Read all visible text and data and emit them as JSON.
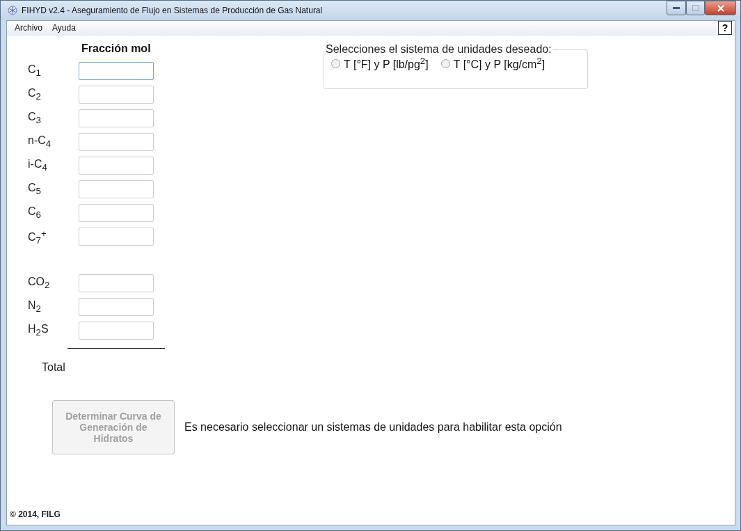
{
  "window": {
    "title": "FIHYD v2.4 - Aseguramiento de Flujo en Sistemas de Producción de Gas Natural"
  },
  "menu": [
    "Archivo",
    "Ayuda"
  ],
  "help_button": "?",
  "column_header": "Fracción mol",
  "component_groups": [
    [
      {
        "label": "C$_{1}$",
        "focused": true
      },
      {
        "label": "C$_{2}$",
        "focused": false
      },
      {
        "label": "C$_{3}$",
        "focused": false
      },
      {
        "label": "n-C$_{4}$",
        "focused": false
      },
      {
        "label": "i-C$_{4}$",
        "focused": false
      },
      {
        "label": "C$_{5}$",
        "focused": false
      },
      {
        "label": "C$_{6}$",
        "focused": false
      },
      {
        "label": "C$_{7}$$^{+}$",
        "focused": false
      }
    ],
    [
      {
        "label": "CO$_{2}$",
        "focused": false
      },
      {
        "label": "N$_{2}$",
        "focused": false
      },
      {
        "label": "H$_{2}$S",
        "focused": false
      }
    ]
  ],
  "total_label": "Total",
  "units": {
    "legend": "Selecciones el sistema de unidades deseado:",
    "options": [
      {
        "label": "T [°F] y P [lb/pg$^{2}$]",
        "selected": false
      },
      {
        "label": "T [°C] y P [kg/cm$^{2}$]",
        "selected": false
      }
    ]
  },
  "action_button": {
    "label": "Determinar Curva de Generación de Hidratos",
    "disabled": true
  },
  "message": "Es necesario seleccionar un sistemas de unidades para habilitar esta opción",
  "footer": "© 2014, FILG"
}
